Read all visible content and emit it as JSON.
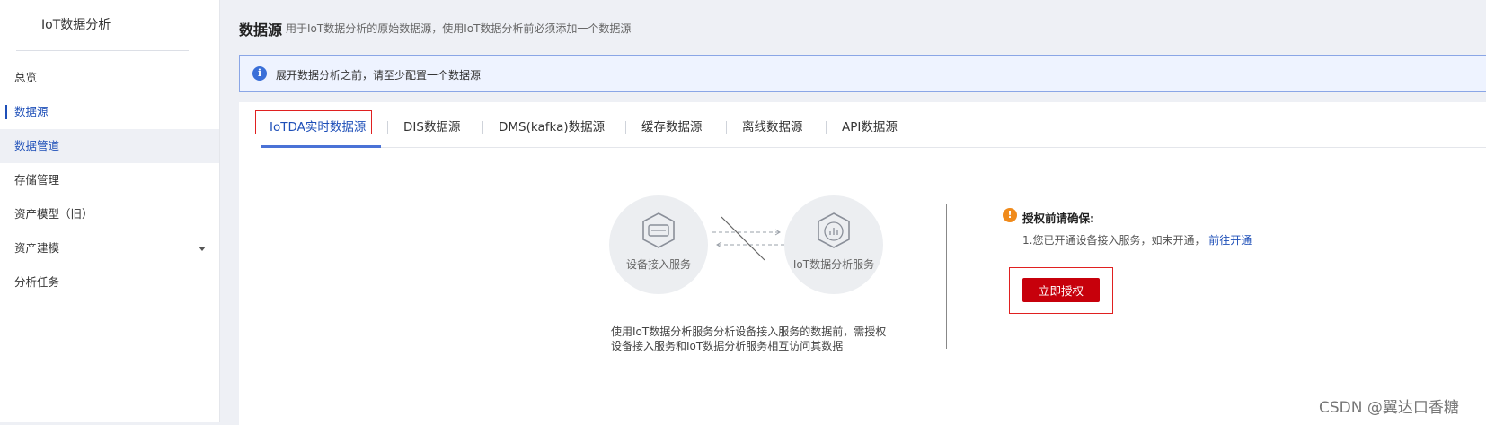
{
  "sidebar": {
    "app_title": "IoT数据分析",
    "items": [
      {
        "label": "总览"
      },
      {
        "label": "数据源"
      },
      {
        "label": "数据管道"
      },
      {
        "label": "存储管理"
      },
      {
        "label": "资产模型（旧）"
      },
      {
        "label": "资产建模"
      },
      {
        "label": "分析任务"
      }
    ],
    "active_item": "数据源",
    "hover_item": "数据管道"
  },
  "header": {
    "title": "数据源",
    "description": "用于IoT数据分析的原始数据源，使用IoT数据分析前必须添加一个数据源"
  },
  "notice": {
    "icon": "info-icon",
    "text": "展开数据分析之前，请至少配置一个数据源"
  },
  "tabs": [
    {
      "label": "IoTDA实时数据源",
      "active": true
    },
    {
      "label": "DIS数据源"
    },
    {
      "label": "DMS(kafka)数据源"
    },
    {
      "label": "缓存数据源"
    },
    {
      "label": "离线数据源"
    },
    {
      "label": "API数据源"
    }
  ],
  "diagram": {
    "left_label": "设备接入服务",
    "right_label": "IoT数据分析服务",
    "description_line1": "使用IoT数据分析服务分析设备接入服务的数据前，需授权",
    "description_line2": "设备接入服务和IoT数据分析服务相互访问其数据"
  },
  "authorize": {
    "warn_icon": "warning-icon",
    "title": "授权前请确保:",
    "line1": "1.您已开通设备接入服务，如未开通，",
    "link": "前往开通",
    "button": "立即授权"
  },
  "colors": {
    "accent": "#1e4fb8",
    "button_red": "#c7000b",
    "highlight_box": "#e02020"
  },
  "watermark": "CSDN @翼达口香糖"
}
